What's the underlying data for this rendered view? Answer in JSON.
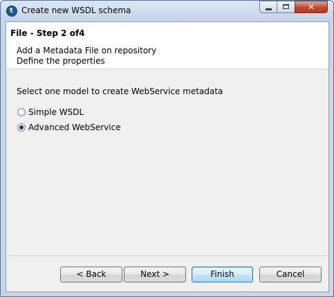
{
  "window": {
    "title": "Create new WSDL schema",
    "app_icon_glyph": "t",
    "controls": {
      "minimize": "minimize-icon",
      "maximize": "maximize-icon",
      "close": "✕"
    }
  },
  "header": {
    "step_title": "File - Step 2 of4",
    "description_line1": "Add a Metadata File on repository",
    "description_line2": "Define the properties"
  },
  "body": {
    "prompt": "Select one model to create WebService metadata",
    "options": [
      {
        "label": "Simple WSDL",
        "selected": false
      },
      {
        "label": "Advanced WebService",
        "selected": true
      }
    ]
  },
  "buttons": {
    "back": "< Back",
    "next": "Next >",
    "finish": "Finish",
    "cancel": "Cancel"
  },
  "colors": {
    "default_button_border": "#3c7fb1",
    "radio_dot": "#1f3b62"
  }
}
